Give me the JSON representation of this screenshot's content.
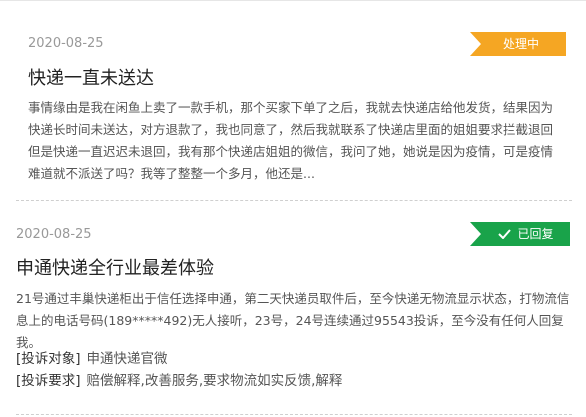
{
  "items": [
    {
      "date": "2020-08-25",
      "status": "处理中",
      "title": "快递一直未送达",
      "body": "事情缘由是我在闲鱼上卖了一款手机，那个买家下单了之后，我就去快递店给他发货，结果因为快递长时间未送达，对方退款了，我也同意了，然后我就联系了快递店里面的姐姐要求拦截退回但是快递一直迟迟未退回，我有那个快递店姐姐的微信，我问了她，她说是因为疫情，可是疫情难道就不派送了吗？我等了整整一个多月，他还是..."
    },
    {
      "date": "2020-08-25",
      "status": "已回复",
      "title": "申通快递全行业最差体验",
      "body": "21号通过丰巢快递柜出于信任选择申通，第二天快递员取件后，至今快递无物流显示状态，打物流信息上的电话号码(189*****492)无人接听，23号，24号连续通过95543投诉，至今没有任何人回复我。",
      "target_label": "[投诉对象]",
      "target_value": "申通快递官微",
      "demand_label": "[投诉要求]",
      "demand_value": "赔偿解释,改善服务,要求物流如实反馈,解释"
    }
  ],
  "colors": {
    "processing": "#f5a623",
    "replied": "#19a34a"
  },
  "icons": {
    "replied": "check-icon"
  }
}
